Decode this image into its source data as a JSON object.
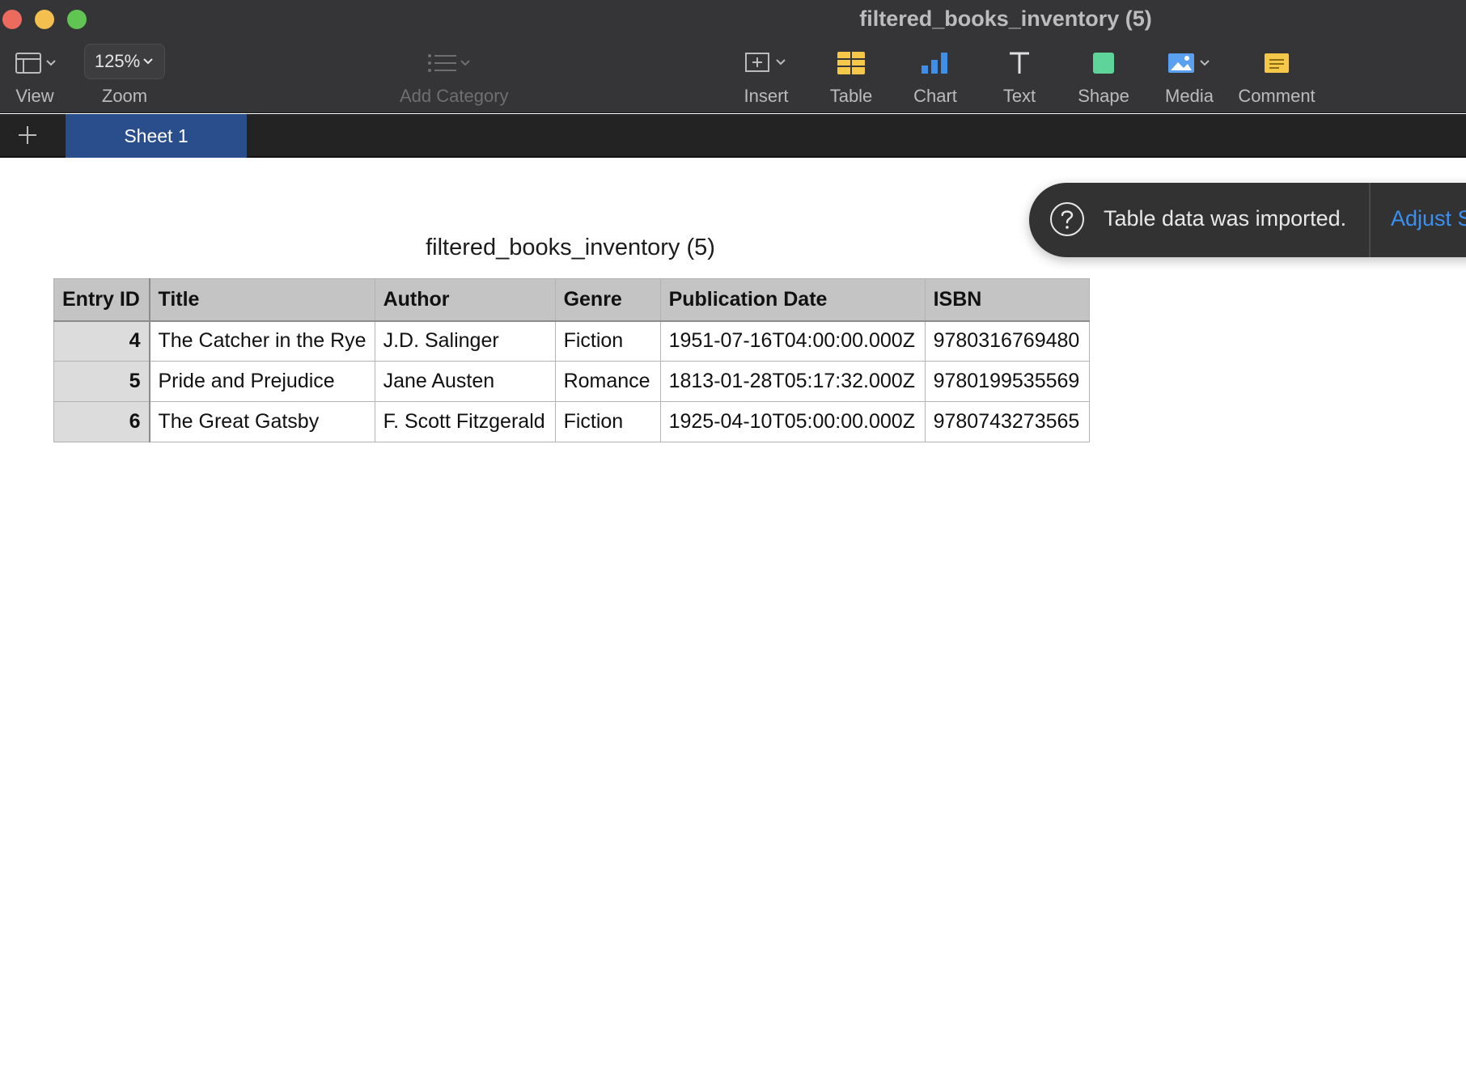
{
  "window": {
    "title": "filtered_books_inventory (5)"
  },
  "toolbar": {
    "view_label": "View",
    "zoom_label": "Zoom",
    "zoom_value": "125%",
    "add_category_label": "Add Category",
    "insert_label": "Insert",
    "table_label": "Table",
    "chart_label": "Chart",
    "text_label": "Text",
    "shape_label": "Shape",
    "media_label": "Media",
    "comment_label": "Comment"
  },
  "tabs": {
    "sheet1": "Sheet 1"
  },
  "table": {
    "title": "filtered_books_inventory (5)",
    "columns": [
      "Entry ID",
      "Title",
      "Author",
      "Genre",
      "Publication Date",
      "ISBN"
    ],
    "rows": [
      [
        "4",
        "The Catcher in the Rye",
        "J.D. Salinger",
        "Fiction",
        "1951-07-16T04:00:00.000Z",
        "9780316769480"
      ],
      [
        "5",
        "Pride and Prejudice",
        "Jane Austen",
        "Romance",
        "1813-01-28T05:17:32.000Z",
        "9780199535569"
      ],
      [
        "6",
        "The Great Gatsby",
        "F. Scott Fitzgerald",
        "Fiction",
        "1925-04-10T05:00:00.000Z",
        "9780743273565"
      ]
    ]
  },
  "notification": {
    "message": "Table data was imported.",
    "action": "Adjust S"
  },
  "colors": {
    "toolbar_bg": "#353437",
    "tab_active": "#2a4e8c",
    "link_blue": "#3b8ff0",
    "table_yellow_icon": "#f5c84a",
    "chart_blue_icon": "#3f8ee8",
    "shape_green_icon": "#5fd49a"
  }
}
